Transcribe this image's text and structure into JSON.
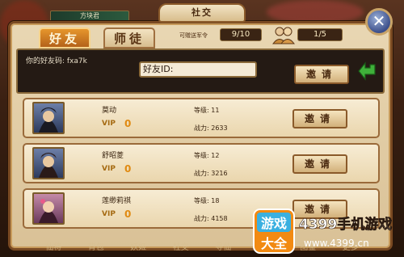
{
  "top_name": "方块君",
  "title": "社交",
  "close_glyph": "✕",
  "tabs": {
    "friends": "好友",
    "mentor": "师徒"
  },
  "gift": {
    "label": "可赠送军令",
    "value": "9/10"
  },
  "friend_count": "1/5",
  "search": {
    "my_code": "你的好友码: fxa7k",
    "id_label": "好友ID:",
    "invite": "邀请"
  },
  "rows": [
    {
      "name": "莫动",
      "vip_label": "VIP",
      "vip": "0",
      "level": "等级: 11",
      "power": "战力: 2633",
      "invite": "邀请"
    },
    {
      "name": "舒昭菱",
      "vip_label": "VIP",
      "vip": "0",
      "level": "等级: 12",
      "power": "战力: 3216",
      "invite": "邀请"
    },
    {
      "name": "莲缈莉祺",
      "vip_label": "VIP",
      "vip": "0",
      "level": "等级: 18",
      "power": "战力: 4158",
      "invite": "邀请"
    }
  ],
  "nav": [
    "仙将",
    "背包",
    "妖姬",
    "社交",
    "寻仙",
    "武将",
    "图鉴",
    "更多"
  ],
  "watermark": {
    "title_a": "游戏",
    "title_b": "大全",
    "brand": "4399手机游戏",
    "url": "www.4399.cn"
  },
  "colors": {
    "accent_orange": "#e6962c",
    "panel_dark": "#241a14",
    "frame_brown": "#7a4a22"
  }
}
